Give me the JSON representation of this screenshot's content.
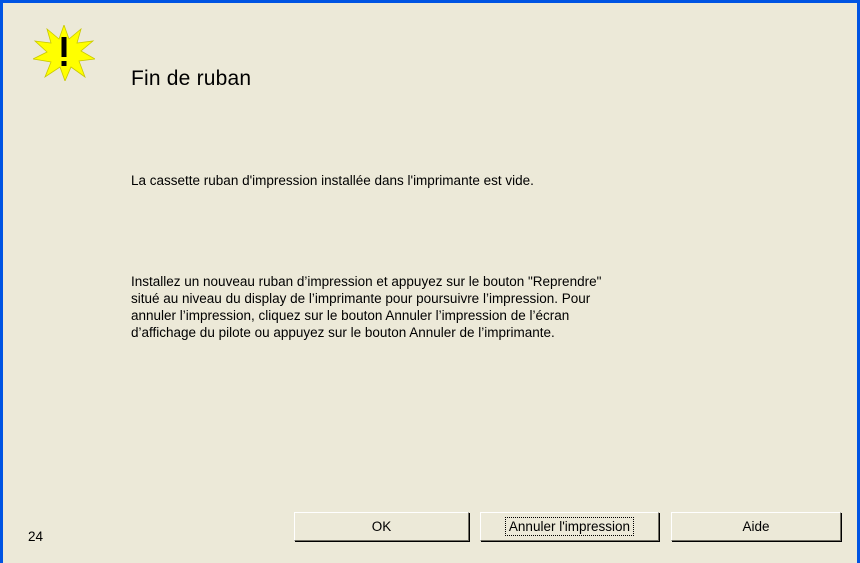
{
  "dialog": {
    "title": "Fin de ruban",
    "message_primary": "La cassette ruban d'impression installée dans l'imprimante est vide.",
    "message_secondary": "Installez un nouveau ruban d’impression et appuyez sur le bouton \"Reprendre\"\nsitué au niveau du display de l’imprimante pour poursuivre l’impression. Pour\nannuler l’impression, cliquez sur le bouton Annuler l’impression de l’écran\nd’affichage du pilote ou appuyez sur le bouton Annuler de l’imprimante.",
    "counter": "24",
    "icon": "warning-starburst-icon"
  },
  "buttons": {
    "ok": "OK",
    "cancel_print": "Annuler l'impression",
    "help": "Aide"
  },
  "colors": {
    "background": "#ece9d8",
    "frame_border": "#0054e3",
    "icon_fill": "#ffff00"
  }
}
